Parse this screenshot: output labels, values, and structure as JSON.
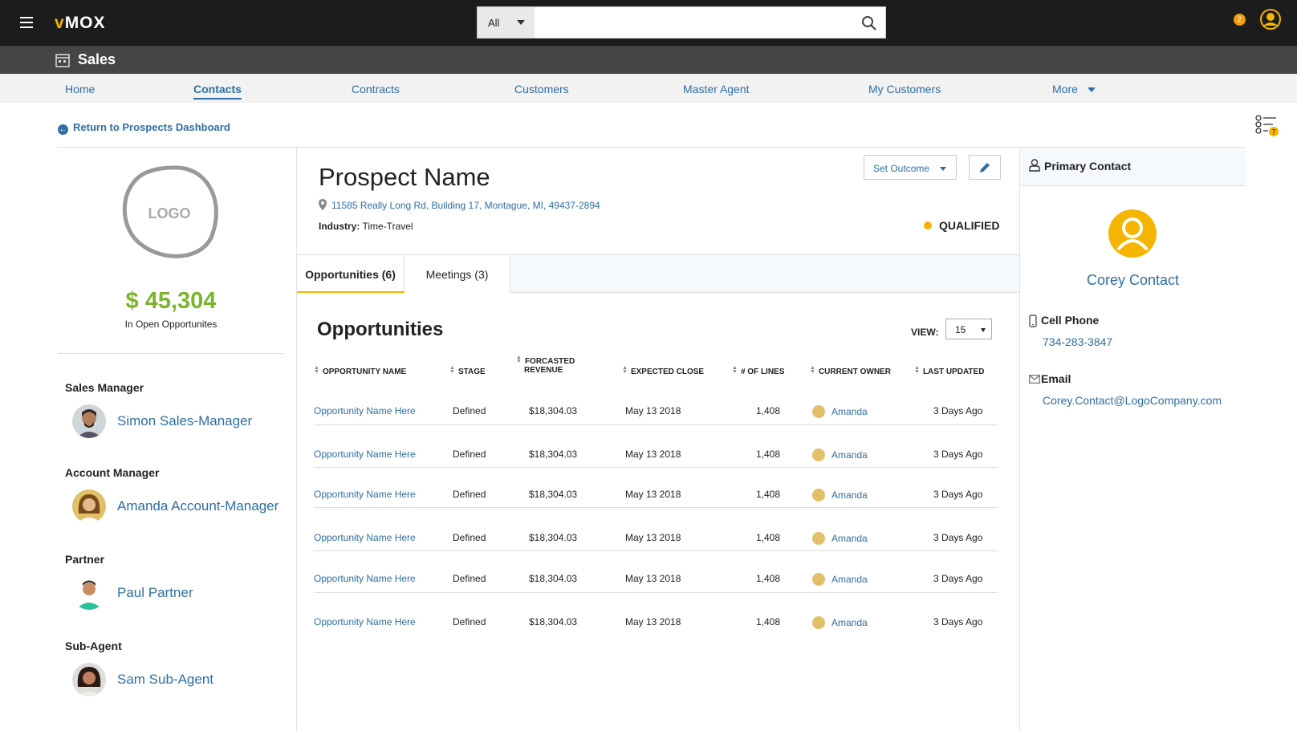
{
  "topbar": {
    "brand_prefix": "v",
    "brand_rest": "MOX",
    "search_scope": "All",
    "search_placeholder": "",
    "notification_count": "2"
  },
  "subheader": {
    "title": "Sales"
  },
  "nav": {
    "items": [
      "Home",
      "Contacts",
      "Contracts",
      "Customers",
      "Master Agent",
      "My Customers",
      "More"
    ]
  },
  "return_link": "Return to Prospects Dashboard",
  "checklist_badge": "7",
  "left": {
    "logo_text": "LOGO",
    "amount": "$ 45,304",
    "amount_label": "In Open Opportunites",
    "team": [
      {
        "role": "Sales Manager",
        "name": "Simon Sales-Manager"
      },
      {
        "role": "Account Manager",
        "name": "Amanda Account-Manager"
      },
      {
        "role": "Partner",
        "name": "Paul Partner"
      },
      {
        "role": "Sub-Agent",
        "name": "Sam Sub-Agent"
      }
    ]
  },
  "prospect": {
    "name": "Prospect Name",
    "address": "11585 Really Long Rd, Building 17, Montague, MI, 49437-2894",
    "industry_label": "Industry:",
    "industry": "Time-Travel",
    "status": "QUALIFIED",
    "set_outcome": "Set Outcome"
  },
  "tabs": [
    "Opportunities (6)",
    "Meetings (3)"
  ],
  "opportunities": {
    "title": "Opportunities",
    "view_label": "VIEW:",
    "view_value": "15",
    "columns": [
      "OPPORTUNITY NAME",
      "STAGE",
      "FORCASTED",
      "REVENUE",
      "EXPECTED CLOSE",
      "# OF LINES",
      "CURRENT OWNER",
      "LAST UPDATED"
    ],
    "rows": [
      {
        "name": "Opportunity Name Here",
        "stage": "Defined",
        "revenue": "$18,304.03",
        "close": "May 13 2018",
        "lines": "1,408",
        "owner": "Amanda",
        "updated": "3 Days Ago"
      },
      {
        "name": "Opportunity Name Here",
        "stage": "Defined",
        "revenue": "$18,304.03",
        "close": "May 13 2018",
        "lines": "1,408",
        "owner": "Amanda",
        "updated": "3 Days Ago"
      },
      {
        "name": "Opportunity Name Here",
        "stage": "Defined",
        "revenue": "$18,304.03",
        "close": "May 13 2018",
        "lines": "1,408",
        "owner": "Amanda",
        "updated": "3 Days Ago"
      },
      {
        "name": "Opportunity Name Here",
        "stage": "Defined",
        "revenue": "$18,304.03",
        "close": "May 13 2018",
        "lines": "1,408",
        "owner": "Amanda",
        "updated": "3 Days Ago"
      },
      {
        "name": "Opportunity Name Here",
        "stage": "Defined",
        "revenue": "$18,304.03",
        "close": "May 13 2018",
        "lines": "1,408",
        "owner": "Amanda",
        "updated": "3 Days Ago"
      },
      {
        "name": "Opportunity Name Here",
        "stage": "Defined",
        "revenue": "$18,304.03",
        "close": "May 13 2018",
        "lines": "1,408",
        "owner": "Amanda",
        "updated": "3 Days Ago"
      }
    ]
  },
  "primary_contact": {
    "heading": "Primary Contact",
    "name": "Corey Contact",
    "phone_label": "Cell Phone",
    "phone": "734-283-3847",
    "email_label": "Email",
    "email": "Corey.Contact@LogoCompany.com"
  },
  "colors": {
    "accent": "#f5b400",
    "link": "#2f6ea5",
    "money": "#7ab52b",
    "topbar": "#1c1c1c"
  }
}
